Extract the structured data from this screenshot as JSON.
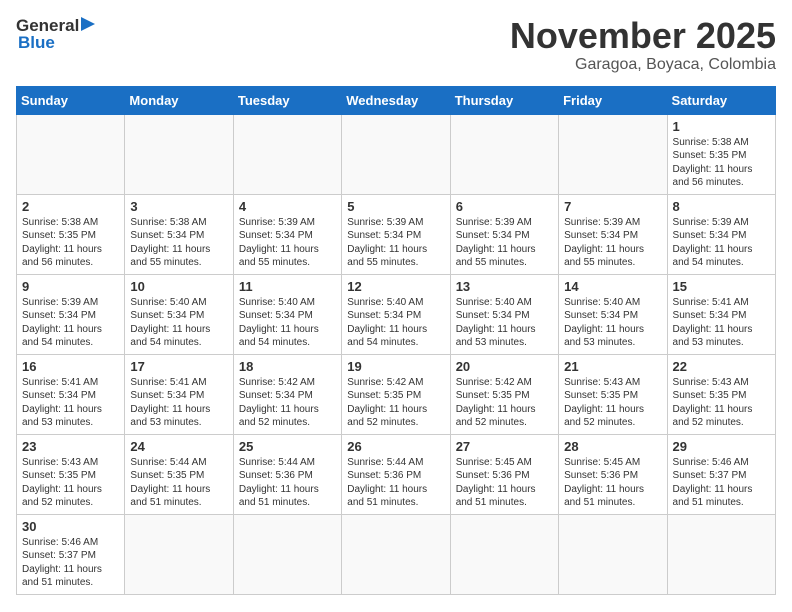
{
  "header": {
    "logo_general": "General",
    "logo_blue": "Blue",
    "month_title": "November 2025",
    "location": "Garagoa, Boyaca, Colombia"
  },
  "weekdays": [
    "Sunday",
    "Monday",
    "Tuesday",
    "Wednesday",
    "Thursday",
    "Friday",
    "Saturday"
  ],
  "weeks": [
    [
      {
        "day": "",
        "info": ""
      },
      {
        "day": "",
        "info": ""
      },
      {
        "day": "",
        "info": ""
      },
      {
        "day": "",
        "info": ""
      },
      {
        "day": "",
        "info": ""
      },
      {
        "day": "",
        "info": ""
      },
      {
        "day": "1",
        "info": "Sunrise: 5:38 AM\nSunset: 5:35 PM\nDaylight: 11 hours\nand 56 minutes."
      }
    ],
    [
      {
        "day": "2",
        "info": "Sunrise: 5:38 AM\nSunset: 5:35 PM\nDaylight: 11 hours\nand 56 minutes."
      },
      {
        "day": "3",
        "info": "Sunrise: 5:38 AM\nSunset: 5:34 PM\nDaylight: 11 hours\nand 55 minutes."
      },
      {
        "day": "4",
        "info": "Sunrise: 5:39 AM\nSunset: 5:34 PM\nDaylight: 11 hours\nand 55 minutes."
      },
      {
        "day": "5",
        "info": "Sunrise: 5:39 AM\nSunset: 5:34 PM\nDaylight: 11 hours\nand 55 minutes."
      },
      {
        "day": "6",
        "info": "Sunrise: 5:39 AM\nSunset: 5:34 PM\nDaylight: 11 hours\nand 55 minutes."
      },
      {
        "day": "7",
        "info": "Sunrise: 5:39 AM\nSunset: 5:34 PM\nDaylight: 11 hours\nand 55 minutes."
      },
      {
        "day": "8",
        "info": "Sunrise: 5:39 AM\nSunset: 5:34 PM\nDaylight: 11 hours\nand 54 minutes."
      }
    ],
    [
      {
        "day": "9",
        "info": "Sunrise: 5:39 AM\nSunset: 5:34 PM\nDaylight: 11 hours\nand 54 minutes."
      },
      {
        "day": "10",
        "info": "Sunrise: 5:40 AM\nSunset: 5:34 PM\nDaylight: 11 hours\nand 54 minutes."
      },
      {
        "day": "11",
        "info": "Sunrise: 5:40 AM\nSunset: 5:34 PM\nDaylight: 11 hours\nand 54 minutes."
      },
      {
        "day": "12",
        "info": "Sunrise: 5:40 AM\nSunset: 5:34 PM\nDaylight: 11 hours\nand 54 minutes."
      },
      {
        "day": "13",
        "info": "Sunrise: 5:40 AM\nSunset: 5:34 PM\nDaylight: 11 hours\nand 53 minutes."
      },
      {
        "day": "14",
        "info": "Sunrise: 5:40 AM\nSunset: 5:34 PM\nDaylight: 11 hours\nand 53 minutes."
      },
      {
        "day": "15",
        "info": "Sunrise: 5:41 AM\nSunset: 5:34 PM\nDaylight: 11 hours\nand 53 minutes."
      }
    ],
    [
      {
        "day": "16",
        "info": "Sunrise: 5:41 AM\nSunset: 5:34 PM\nDaylight: 11 hours\nand 53 minutes."
      },
      {
        "day": "17",
        "info": "Sunrise: 5:41 AM\nSunset: 5:34 PM\nDaylight: 11 hours\nand 53 minutes."
      },
      {
        "day": "18",
        "info": "Sunrise: 5:42 AM\nSunset: 5:34 PM\nDaylight: 11 hours\nand 52 minutes."
      },
      {
        "day": "19",
        "info": "Sunrise: 5:42 AM\nSunset: 5:35 PM\nDaylight: 11 hours\nand 52 minutes."
      },
      {
        "day": "20",
        "info": "Sunrise: 5:42 AM\nSunset: 5:35 PM\nDaylight: 11 hours\nand 52 minutes."
      },
      {
        "day": "21",
        "info": "Sunrise: 5:43 AM\nSunset: 5:35 PM\nDaylight: 11 hours\nand 52 minutes."
      },
      {
        "day": "22",
        "info": "Sunrise: 5:43 AM\nSunset: 5:35 PM\nDaylight: 11 hours\nand 52 minutes."
      }
    ],
    [
      {
        "day": "23",
        "info": "Sunrise: 5:43 AM\nSunset: 5:35 PM\nDaylight: 11 hours\nand 52 minutes."
      },
      {
        "day": "24",
        "info": "Sunrise: 5:44 AM\nSunset: 5:35 PM\nDaylight: 11 hours\nand 51 minutes."
      },
      {
        "day": "25",
        "info": "Sunrise: 5:44 AM\nSunset: 5:36 PM\nDaylight: 11 hours\nand 51 minutes."
      },
      {
        "day": "26",
        "info": "Sunrise: 5:44 AM\nSunset: 5:36 PM\nDaylight: 11 hours\nand 51 minutes."
      },
      {
        "day": "27",
        "info": "Sunrise: 5:45 AM\nSunset: 5:36 PM\nDaylight: 11 hours\nand 51 minutes."
      },
      {
        "day": "28",
        "info": "Sunrise: 5:45 AM\nSunset: 5:36 PM\nDaylight: 11 hours\nand 51 minutes."
      },
      {
        "day": "29",
        "info": "Sunrise: 5:46 AM\nSunset: 5:37 PM\nDaylight: 11 hours\nand 51 minutes."
      }
    ],
    [
      {
        "day": "30",
        "info": "Sunrise: 5:46 AM\nSunset: 5:37 PM\nDaylight: 11 hours\nand 51 minutes."
      },
      {
        "day": "",
        "info": ""
      },
      {
        "day": "",
        "info": ""
      },
      {
        "day": "",
        "info": ""
      },
      {
        "day": "",
        "info": ""
      },
      {
        "day": "",
        "info": ""
      },
      {
        "day": "",
        "info": ""
      }
    ]
  ]
}
